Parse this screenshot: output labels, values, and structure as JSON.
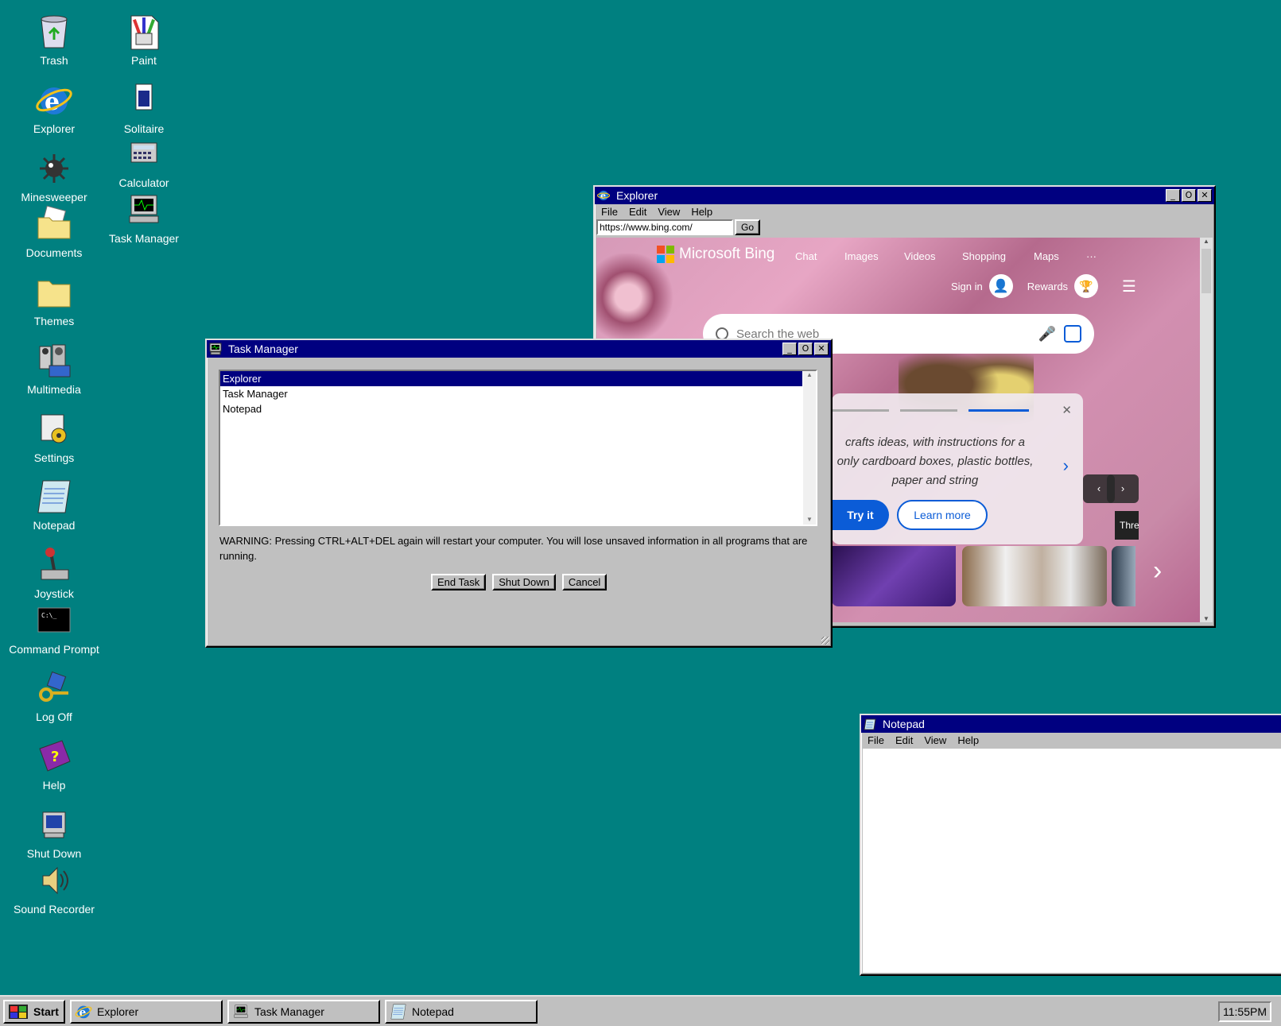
{
  "desktop": {
    "col1": [
      {
        "label": "Trash",
        "icon": "recycle-bin-icon"
      },
      {
        "label": "Explorer",
        "icon": "internet-explorer-icon"
      },
      {
        "label": "Minesweeper",
        "icon": "mine-icon"
      },
      {
        "label": "Documents",
        "icon": "documents-folder-icon"
      },
      {
        "label": "Themes",
        "icon": "folder-icon"
      },
      {
        "label": "Multimedia",
        "icon": "multimedia-icon"
      },
      {
        "label": "Settings",
        "icon": "settings-icon"
      },
      {
        "label": "Notepad",
        "icon": "notepad-icon"
      },
      {
        "label": "Joystick",
        "icon": "joystick-icon"
      },
      {
        "label": "Command Prompt",
        "icon": "command-prompt-icon"
      },
      {
        "label": "Log Off",
        "icon": "log-off-key-icon"
      },
      {
        "label": "Help",
        "icon": "help-book-icon"
      },
      {
        "label": "Shut Down",
        "icon": "shut-down-icon"
      },
      {
        "label": "Sound Recorder",
        "icon": "speaker-icon"
      }
    ],
    "col2": [
      {
        "label": "Paint",
        "icon": "paint-icon"
      },
      {
        "label": "Solitaire",
        "icon": "cards-icon"
      },
      {
        "label": "Calculator",
        "icon": "calculator-icon"
      },
      {
        "label": "Task Manager",
        "icon": "task-manager-icon"
      }
    ]
  },
  "explorer": {
    "title": "Explorer",
    "menu": [
      "File",
      "Edit",
      "View",
      "Help"
    ],
    "url": "https://www.bing.com/",
    "go": "Go",
    "bing": {
      "brand": "Microsoft Bing",
      "nav": [
        "Chat",
        "Images",
        "Videos",
        "Shopping",
        "Maps",
        "···"
      ],
      "sign_in": "Sign in",
      "rewards": "Rewards",
      "search_placeholder": "Search the web",
      "card_text_1": "crafts ideas, with instructions for a",
      "card_text_2": "only cardboard boxes, plastic bottles,",
      "card_text_3": "paper and string",
      "try_it": "Try it",
      "learn_more": "Learn more",
      "thumb_label": "Thre"
    }
  },
  "taskmanager": {
    "title": "Task Manager",
    "items": [
      "Explorer",
      "Task Manager",
      "Notepad"
    ],
    "selected": 0,
    "warning": "WARNING: Pressing CTRL+ALT+DEL again will restart your computer. You will lose unsaved information in all programs that are running.",
    "buttons": {
      "end_task": "End Task",
      "shut_down": "Shut Down",
      "cancel": "Cancel"
    }
  },
  "notepad": {
    "title": "Notepad",
    "menu": [
      "File",
      "Edit",
      "View",
      "Help"
    ],
    "content": ""
  },
  "taskbar": {
    "start": "Start",
    "items": [
      "Explorer",
      "Task Manager",
      "Notepad"
    ],
    "clock": "11:55PM"
  }
}
